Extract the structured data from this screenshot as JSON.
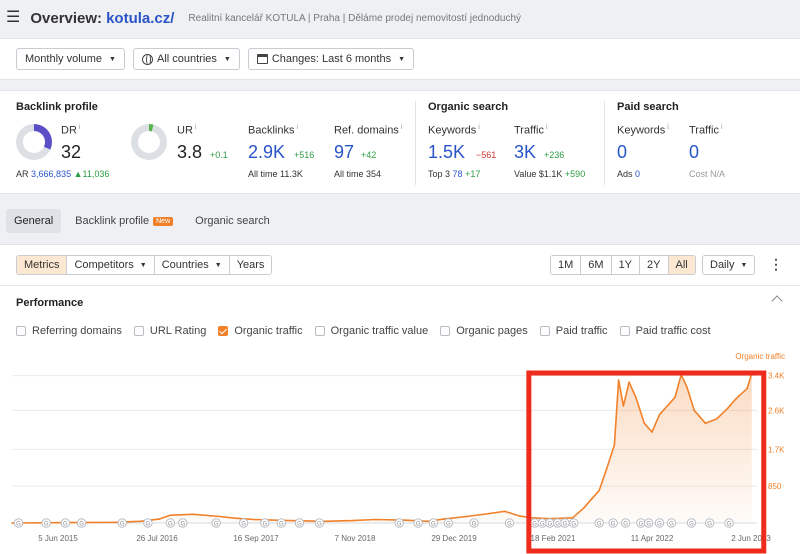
{
  "header": {
    "menu_icon": "hamburger-icon",
    "overview_prefix": "Overview:",
    "domain": "kotula.cz/",
    "subtitle": "Realitní kancelář KOTULA | Praha | Děláme prodej nemovitostí jednoduchý"
  },
  "filters": {
    "volume": "Monthly volume",
    "countries": "All countries",
    "changes": "Changes: Last 6 months"
  },
  "backlink_profile": {
    "title": "Backlink profile",
    "dr": {
      "label": "DR",
      "value": "32",
      "ar_label": "AR",
      "ar_value": "3,666,835",
      "ar_delta": "▲11,036"
    },
    "ur": {
      "label": "UR",
      "value": "3.8",
      "delta": "+0.1"
    },
    "backlinks": {
      "label": "Backlinks",
      "value": "2.9K",
      "delta": "+516",
      "sub": "All time 11.3K"
    },
    "ref_domains": {
      "label": "Ref. domains",
      "value": "97",
      "delta": "+42",
      "sub": "All time 354"
    }
  },
  "organic_search": {
    "title": "Organic search",
    "keywords": {
      "label": "Keywords",
      "value": "1.5K",
      "delta": "−561",
      "sub_label": "Top 3",
      "sub_value": "78",
      "sub_delta": "+17"
    },
    "traffic": {
      "label": "Traffic",
      "value": "3K",
      "delta": "+236",
      "sub_label": "Value",
      "sub_value": "$1.1K",
      "sub_delta": "+590"
    }
  },
  "paid_search": {
    "title": "Paid search",
    "keywords": {
      "label": "Keywords",
      "value": "0",
      "sub_label": "Ads",
      "sub_value": "0"
    },
    "traffic": {
      "label": "Traffic",
      "value": "0",
      "sub_label": "Cost",
      "sub_value": "N/A"
    }
  },
  "tabs": [
    {
      "label": "General",
      "active": true
    },
    {
      "label": "Backlink profile",
      "badge": "New"
    },
    {
      "label": "Organic search"
    }
  ],
  "controls": {
    "left_segments": [
      "Metrics",
      "Competitors",
      "Countries",
      "Years"
    ],
    "left_active": "Metrics",
    "ranges": [
      "1M",
      "6M",
      "1Y",
      "2Y",
      "All"
    ],
    "range_active": "All",
    "granularity": "Daily"
  },
  "performance": {
    "title": "Performance",
    "checkboxes": [
      {
        "label": "Referring domains",
        "checked": false
      },
      {
        "label": "URL Rating",
        "checked": false
      },
      {
        "label": "Organic traffic",
        "checked": true
      },
      {
        "label": "Organic traffic value",
        "checked": false
      },
      {
        "label": "Organic pages",
        "checked": false
      },
      {
        "label": "Paid traffic",
        "checked": false
      },
      {
        "label": "Paid traffic cost",
        "checked": false
      }
    ]
  },
  "colors": {
    "accent": "#f0812a",
    "link_blue": "#2a55c9",
    "positive": "#2c9d43",
    "negative": "#d23333",
    "highlight_box": "#ee2b1c"
  },
  "chart_data": {
    "type": "area",
    "series": [
      {
        "name": "Organic traffic",
        "points": [
          [
            "2015-06-05",
            0
          ],
          [
            "2015-10-01",
            5
          ],
          [
            "2016-02-01",
            10
          ],
          [
            "2016-07-26",
            15
          ],
          [
            "2016-11-01",
            40
          ],
          [
            "2017-01-15",
            90
          ],
          [
            "2017-03-01",
            180
          ],
          [
            "2017-06-01",
            200
          ],
          [
            "2017-09-16",
            150
          ],
          [
            "2017-11-15",
            110
          ],
          [
            "2018-02-01",
            80
          ],
          [
            "2018-06-01",
            60
          ],
          [
            "2018-11-07",
            40
          ],
          [
            "2019-03-01",
            55
          ],
          [
            "2019-06-01",
            80
          ],
          [
            "2019-10-01",
            65
          ],
          [
            "2019-12-29",
            40
          ],
          [
            "2020-03-01",
            90
          ],
          [
            "2020-06-01",
            150
          ],
          [
            "2020-09-01",
            220
          ],
          [
            "2020-11-01",
            270
          ],
          [
            "2021-01-01",
            160
          ],
          [
            "2021-02-18",
            120
          ],
          [
            "2021-05-01",
            100
          ],
          [
            "2021-08-01",
            120
          ],
          [
            "2021-09-15",
            350
          ],
          [
            "2021-10-15",
            550
          ],
          [
            "2021-11-15",
            750
          ],
          [
            "2021-12-15",
            1250
          ],
          [
            "2022-01-15",
            1800
          ],
          [
            "2022-02-01",
            3300
          ],
          [
            "2022-02-20",
            2700
          ],
          [
            "2022-03-15",
            3250
          ],
          [
            "2022-04-11",
            2900
          ],
          [
            "2022-05-15",
            2300
          ],
          [
            "2022-06-15",
            2100
          ],
          [
            "2022-07-15",
            2500
          ],
          [
            "2022-08-15",
            2700
          ],
          [
            "2022-09-15",
            2900
          ],
          [
            "2022-10-10",
            3420
          ],
          [
            "2022-11-01",
            3150
          ],
          [
            "2022-12-01",
            2600
          ],
          [
            "2023-01-15",
            2300
          ],
          [
            "2023-03-01",
            2400
          ],
          [
            "2023-04-15",
            2650
          ],
          [
            "2023-05-15",
            2850
          ],
          [
            "2023-06-02",
            2950
          ],
          [
            "2023-07-01",
            3100
          ],
          [
            "2023-07-20",
            3450
          ]
        ]
      }
    ],
    "x_tick_labels": [
      "5 Jun 2015",
      "26 Jul 2016",
      "16 Sep 2017",
      "7 Nov 2018",
      "29 Dec 2019",
      "18 Feb 2021",
      "11 Apr 2022",
      "2 Jun 2023"
    ],
    "y_ticks": [
      850,
      1700,
      2600,
      3400
    ],
    "y_tick_labels": [
      "850",
      "1.7K",
      "2.6K",
      "3.4K"
    ],
    "y_axis_label": "Organic traffic",
    "ylim": [
      0,
      3600
    ],
    "grid": true,
    "annotation_marker": "G",
    "annotation_dates": [
      "2015-07-01",
      "2015-10-20",
      "2016-01-05",
      "2016-03-10",
      "2016-08-20",
      "2016-12-01",
      "2017-03-01",
      "2017-04-20",
      "2017-09-01",
      "2017-12-20",
      "2018-03-15",
      "2018-05-20",
      "2018-08-01",
      "2018-10-20",
      "2019-09-05",
      "2019-11-20",
      "2020-01-20",
      "2020-03-20",
      "2020-07-01",
      "2020-11-20",
      "2021-03-01",
      "2021-04-01",
      "2021-05-01",
      "2021-06-01",
      "2021-07-01",
      "2021-08-05",
      "2021-11-15",
      "2022-01-10",
      "2022-03-01",
      "2022-05-01",
      "2022-06-01",
      "2022-07-15",
      "2022-09-01",
      "2022-11-20",
      "2023-02-01",
      "2023-04-20"
    ],
    "highlighted_range": [
      "2021-02-18",
      "2023-07-20"
    ]
  }
}
